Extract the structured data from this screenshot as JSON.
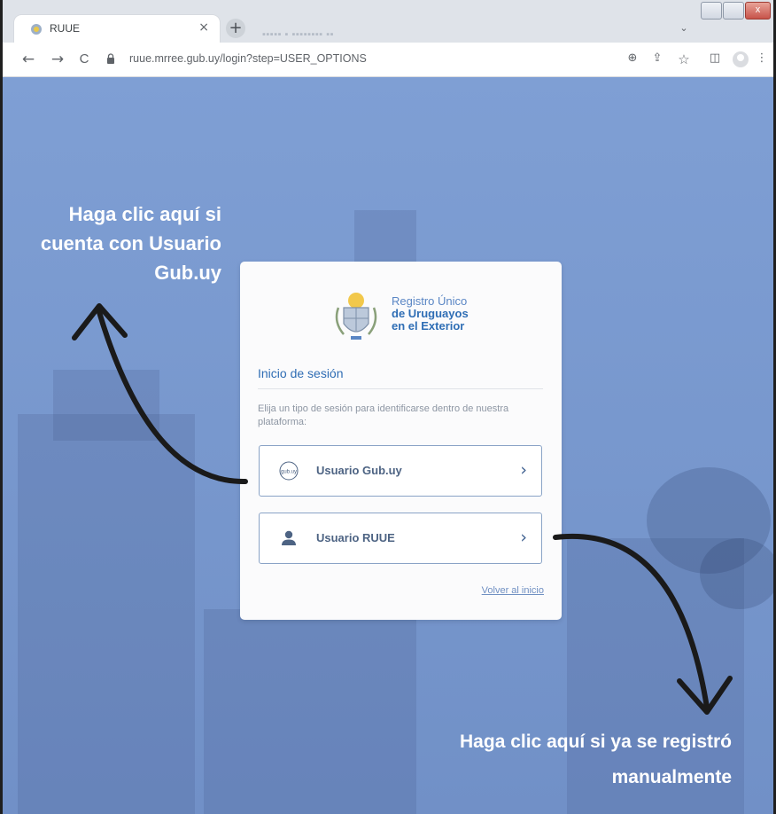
{
  "browser": {
    "tab_title": "RUUE",
    "tab_close": "×",
    "new_tab": "+",
    "blurred_tab": "▪▪▪▪▪ ▪ ▪▪▪▪▪▪▪▪ ▪▪",
    "url": "ruue.mrree.gub.uy/login?step=USER_OPTIONS",
    "back": "←",
    "forward": "→",
    "reload": "C",
    "zoom_icon": "⊕",
    "share_icon": "⇪",
    "star_icon": "☆",
    "sidepanel_icon": "◫",
    "menu_icon": "⋮",
    "tab_search": "⌄",
    "win_close": "x"
  },
  "card": {
    "logo": {
      "line1": "Registro Único",
      "line2": "de Uruguayos",
      "line3": "en el Exterior"
    },
    "title": "Inicio de sesión",
    "description": "Elija un tipo de sesión para identificarse dentro de nuestra plataforma:",
    "options": [
      {
        "label": "Usuario Gub.uy",
        "icon": "gubuy-icon",
        "badge": "gub.uy",
        "chevron": "›"
      },
      {
        "label": "Usuario RUUE",
        "icon": "user-icon",
        "chevron": "›"
      }
    ],
    "back_link": "Volver al inicio"
  },
  "annotations": {
    "gubuy": [
      "Haga clic aquí si",
      "cuenta con Usuario",
      "Gub.uy"
    ],
    "manual": [
      "Haga clic aquí si ya se registró",
      "manualmente"
    ]
  },
  "colors": {
    "page_bg": "#7f9fd4",
    "accent": "#2f6eb5",
    "annotation_text": "#ffffff",
    "arrow": "#1a1a1a"
  }
}
